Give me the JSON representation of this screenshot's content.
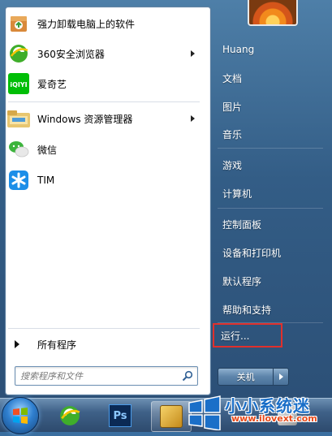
{
  "left_pane": {
    "programs": [
      {
        "label": "强力卸载电脑上的软件",
        "icon": "uninstall-box-icon",
        "submenu": false
      },
      {
        "label": "360安全浏览器",
        "icon": "360-browser-icon",
        "submenu": true
      },
      {
        "label": "爱奇艺",
        "icon": "iqiyi-icon",
        "submenu": false
      },
      {
        "label": "Windows 资源管理器",
        "icon": "explorer-folder-icon",
        "submenu": true
      },
      {
        "label": "微信",
        "icon": "wechat-icon",
        "submenu": false
      },
      {
        "label": "TIM",
        "icon": "tim-icon",
        "submenu": false
      }
    ],
    "all_programs_label": "所有程序",
    "search_placeholder": "搜索程序和文件",
    "iqiyi_logo_text": "iQIYI"
  },
  "right_pane": {
    "items": [
      {
        "label": "Huang"
      },
      {
        "label": "文档"
      },
      {
        "label": "图片"
      },
      {
        "label": "音乐"
      },
      {
        "label": "游戏"
      },
      {
        "label": "计算机"
      },
      {
        "label": "控制面板"
      },
      {
        "label": "设备和打印机"
      },
      {
        "label": "默认程序"
      },
      {
        "label": "帮助和支持"
      },
      {
        "label": "运行..."
      }
    ],
    "highlight_color": "#e0302c",
    "shutdown_label": "关机"
  },
  "taskbar": {
    "ps_label": "Ps"
  },
  "watermark": {
    "title": "小小系统迷",
    "url": "www.ilovext.com"
  }
}
